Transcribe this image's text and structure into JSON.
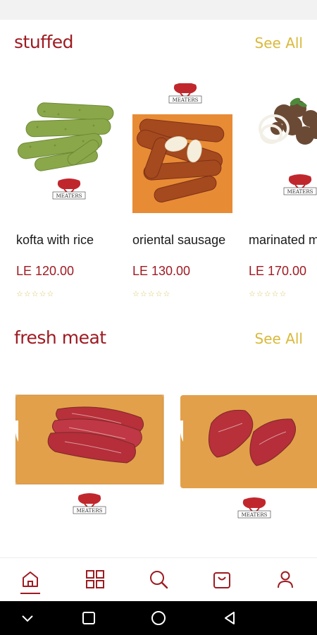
{
  "colors": {
    "brand": "#9e1b22",
    "accent": "#d9b93a",
    "rating": "#d6c66b"
  },
  "sections": [
    {
      "title": "stuffed",
      "see_all_label": "See All",
      "products": [
        {
          "name": "kofta with rice",
          "price": "LE 120.00",
          "rating": "☆☆☆☆☆",
          "brand_mark": "MEATERS"
        },
        {
          "name": "oriental sausage",
          "price": "LE 130.00",
          "rating": "☆☆☆☆☆",
          "brand_mark": "MEATERS"
        },
        {
          "name": "marinated m",
          "price": "LE 170.00",
          "rating": "☆☆☆☆☆",
          "brand_mark": "MEATERS"
        }
      ]
    },
    {
      "title": "fresh meat",
      "see_all_label": "See All",
      "products": [
        {
          "brand_mark": "MEATERS"
        },
        {
          "brand_mark": "MEATERS"
        }
      ]
    }
  ],
  "bottom_nav": {
    "items": [
      {
        "icon": "home-icon",
        "active": true
      },
      {
        "icon": "grid-icon",
        "active": false
      },
      {
        "icon": "search-icon",
        "active": false
      },
      {
        "icon": "cart-icon",
        "active": false
      },
      {
        "icon": "user-icon",
        "active": false
      }
    ]
  },
  "system_nav": {
    "icons": [
      "chevron-down-icon",
      "recents-icon",
      "home-circle-icon",
      "back-icon"
    ]
  }
}
